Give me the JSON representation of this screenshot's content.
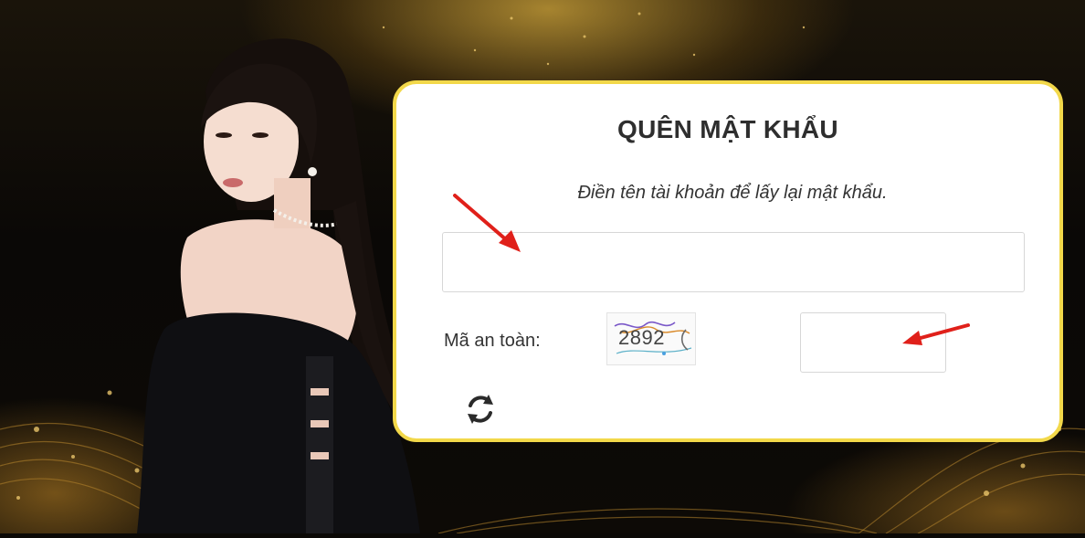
{
  "card": {
    "title": "QUÊN MẬT KHẨU",
    "subtitle": "Điền tên tài khoản để lấy lại mật khẩu.",
    "username_value": "",
    "captcha_label": "Mã an toàn:",
    "captcha_code": "2892",
    "captcha_value": ""
  },
  "icons": {
    "refresh": "refresh-icon",
    "arrow": "red-arrow-icon"
  },
  "colors": {
    "card_border": "#f2d84a",
    "arrow": "#e0201a",
    "title": "#2e2e2e",
    "background_gold": "#d6aa3c"
  }
}
